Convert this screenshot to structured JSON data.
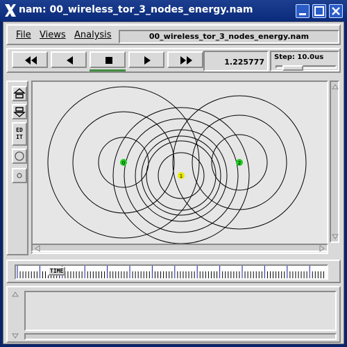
{
  "window": {
    "title": "nam: 00_wireless_tor_3_nodes_energy.nam",
    "accent": "#0a246a"
  },
  "menu": {
    "file": "File",
    "views": "Views",
    "analysis": "Analysis",
    "filename": "00_wireless_tor_3_nodes_energy.nam"
  },
  "controls": {
    "buttons": [
      "fast-rewind-icon",
      "play-backward-icon",
      "stop-icon",
      "play-forward-icon",
      "fast-forward-icon"
    ],
    "active_button": "stop",
    "time": "1.225777",
    "step_label": "Step: 10.0us"
  },
  "tools": {
    "edit_label": "ED\nIT",
    "icons": [
      "zoom-in-icon",
      "zoom-out-icon",
      "edit-icon",
      "circle-tool-icon",
      "point-tool-icon"
    ]
  },
  "network": {
    "nodes": [
      {
        "id": "0",
        "color": "#22cc22"
      },
      {
        "id": "1",
        "color": "#e8e800"
      },
      {
        "id": "2",
        "color": "#22cc22"
      }
    ]
  },
  "timeline": {
    "label": "TIME"
  }
}
